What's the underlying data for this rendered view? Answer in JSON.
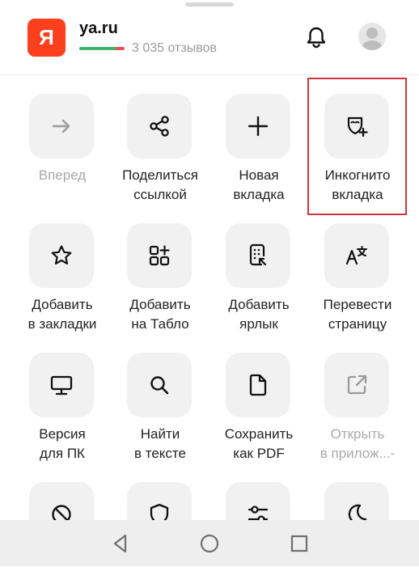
{
  "header": {
    "logo_letter": "Я",
    "site": "ya.ru",
    "reviews": "3 035 отзывов"
  },
  "menu": [
    {
      "label1": "Вперед",
      "label2": "",
      "icon": "arrow-right-icon"
    },
    {
      "label1": "Поделиться",
      "label2": "ссылкой",
      "icon": "share-icon"
    },
    {
      "label1": "Новая",
      "label2": "вкладка",
      "icon": "plus-icon"
    },
    {
      "label1": "Инкогнито",
      "label2": "вкладка",
      "icon": "incognito-mask-icon"
    },
    {
      "label1": "Добавить",
      "label2": "в закладки",
      "icon": "star-icon"
    },
    {
      "label1": "Добавить",
      "label2": "на Табло",
      "icon": "grid-plus-icon"
    },
    {
      "label1": "Добавить",
      "label2": "ярлык",
      "icon": "shortcut-icon"
    },
    {
      "label1": "Перевести",
      "label2": "страницу",
      "icon": "translate-icon"
    },
    {
      "label1": "Версия",
      "label2": "для ПК",
      "icon": "desktop-icon"
    },
    {
      "label1": "Найти",
      "label2": "в тексте",
      "icon": "search-icon"
    },
    {
      "label1": "Сохранить",
      "label2": "как PDF",
      "icon": "document-icon"
    },
    {
      "label1": "Открыть",
      "label2": "в прилож...-",
      "icon": "open-external-icon"
    },
    {
      "label1": "",
      "label2": "",
      "icon": "block-icon"
    },
    {
      "label1": "",
      "label2": "",
      "icon": "shield-icon"
    },
    {
      "label1": "",
      "label2": "",
      "icon": "sliders-icon"
    },
    {
      "label1": "",
      "label2": "",
      "icon": "moon-icon"
    }
  ],
  "colors": {
    "brand": "#fc3f1d",
    "highlight": "#d1343f",
    "tile_bg": "#f1f1f1",
    "disabled_text": "#a9a9a9"
  },
  "nav": [
    "back-icon",
    "home-icon",
    "recents-icon"
  ]
}
